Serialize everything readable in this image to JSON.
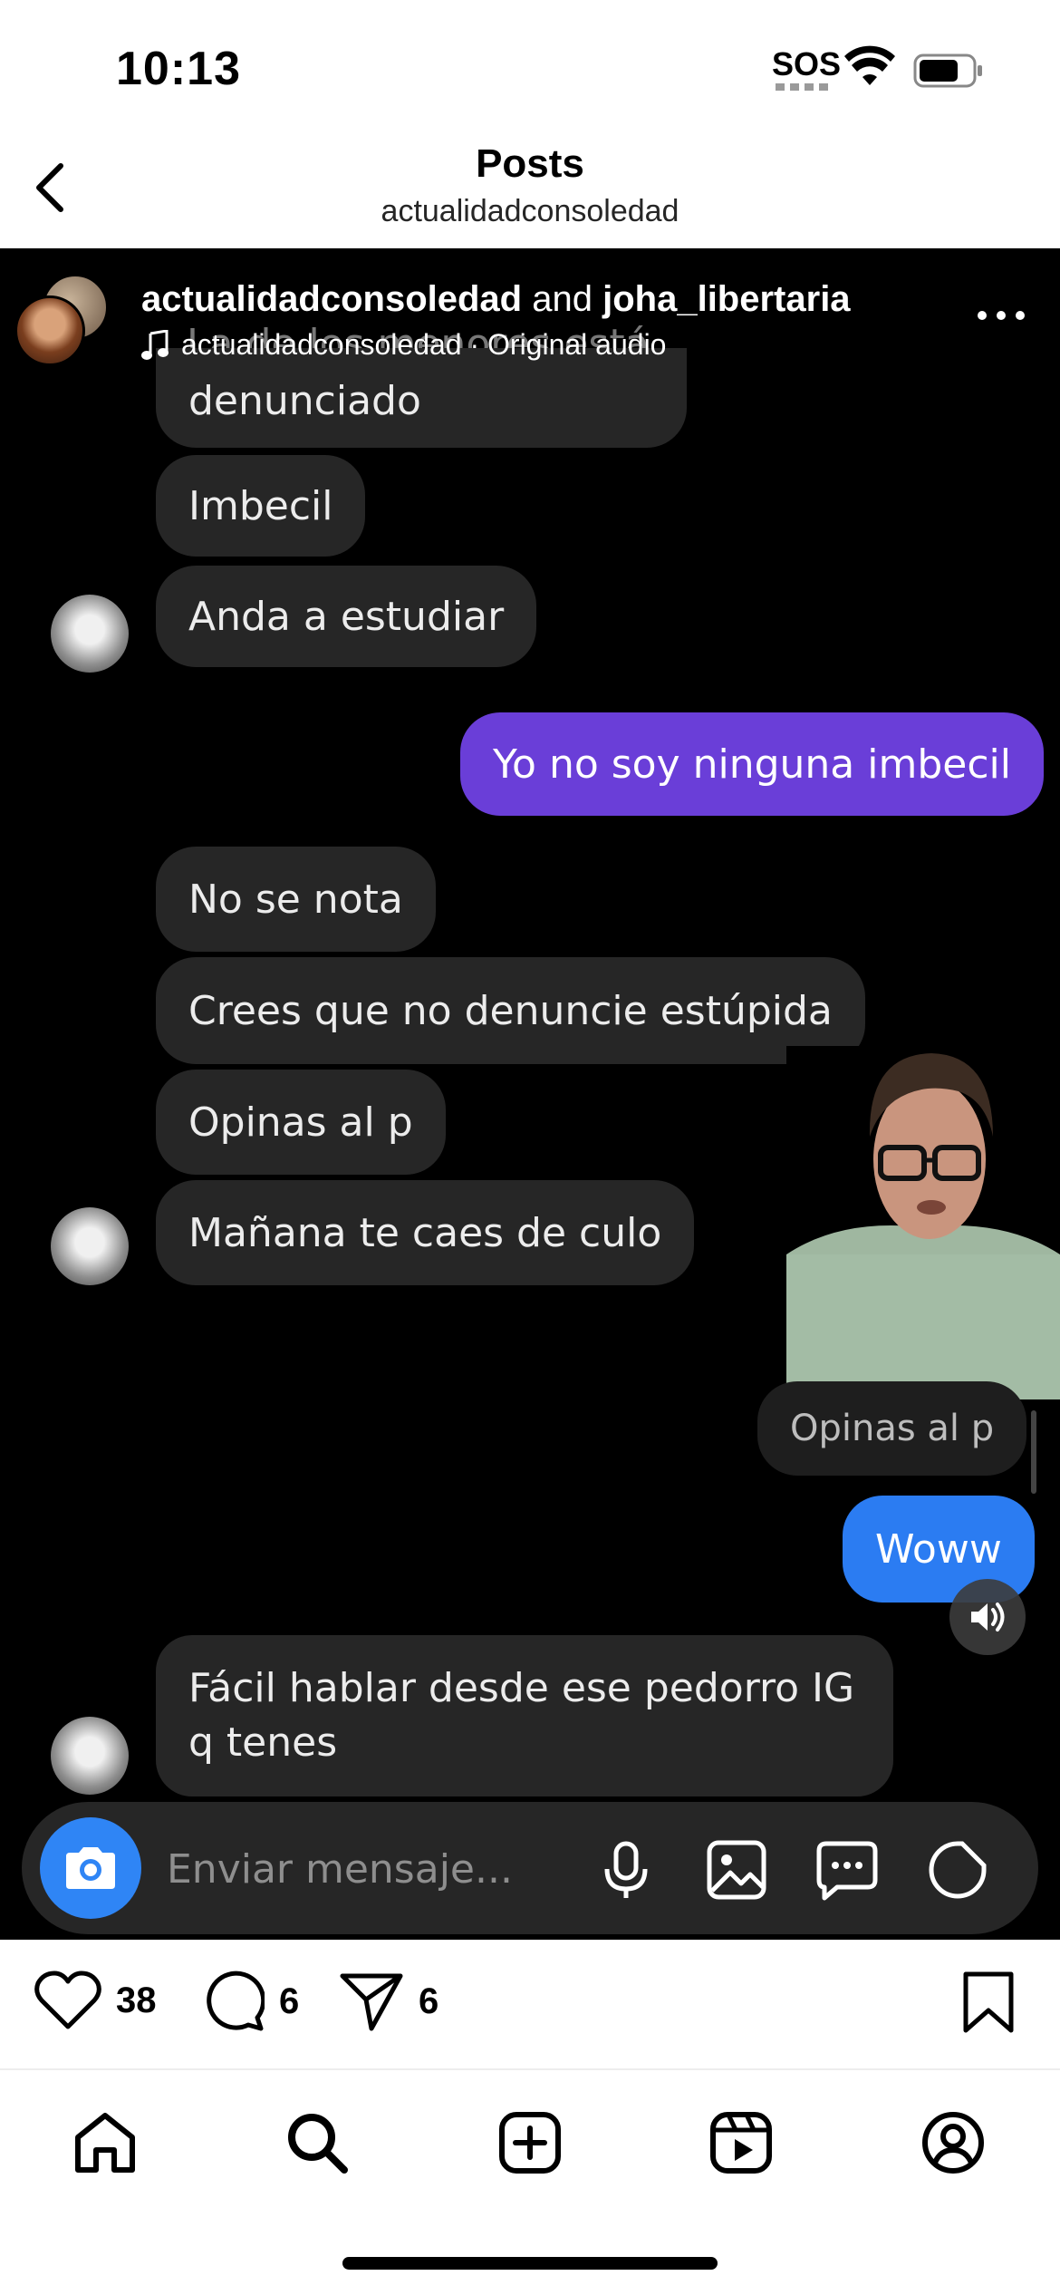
{
  "status_bar": {
    "time": "10:13",
    "sos": "SOS"
  },
  "header": {
    "title": "Posts",
    "subtitle": "actualidadconsoledad"
  },
  "post": {
    "owner_primary": "actualidadconsoledad",
    "owner_joiner": "and",
    "owner_secondary": "joha_libertaria",
    "audio_label": "actualidadconsoledad · Original audio"
  },
  "chat": {
    "ghost_line": "La de los menores está",
    "messages": [
      {
        "text": "denunciado",
        "from": "them"
      },
      {
        "text": "Imbecil",
        "from": "them"
      },
      {
        "text": "Anda a estudiar",
        "from": "them"
      },
      {
        "text": "Yo no soy ninguna imbecil",
        "from": "me"
      },
      {
        "text": "No se nota",
        "from": "them"
      },
      {
        "text": "Crees que no denuncie estúpida",
        "from": "them"
      },
      {
        "text": "Opinas al p",
        "from": "them"
      },
      {
        "text": "Mañana te caes de culo",
        "from": "them"
      },
      {
        "text": "Opinas al p",
        "from": "reply-quote"
      },
      {
        "text": "Woww",
        "from": "me"
      },
      {
        "text": "Fácil hablar desde ese pedorro  IG",
        "from": "them"
      },
      {
        "text": "q tenes",
        "from": "them"
      }
    ],
    "composer_placeholder": "Enviar mensaje..."
  },
  "actions": {
    "likes": "38",
    "comments": "6",
    "shares": "6"
  },
  "colors": {
    "my_bubble_purple": "#6a3ed8",
    "my_bubble_blue": "#2b7cf2",
    "their_bubble": "#262626",
    "camera_button": "#2f85f5"
  },
  "icons": {
    "back": "chevron-left-icon",
    "more": "more-horizontal-icon",
    "audio": "music-note-icon",
    "camera": "camera-icon",
    "mic": "microphone-icon",
    "gallery": "image-icon",
    "chat": "chat-bubble-icon",
    "sticker": "sticker-icon",
    "volume": "speaker-icon",
    "like": "heart-icon",
    "comment": "comment-icon",
    "share": "send-icon",
    "save": "bookmark-icon",
    "tab_home": "home-icon",
    "tab_search": "search-icon",
    "tab_create": "plus-square-icon",
    "tab_reels": "reels-icon",
    "tab_profile": "profile-icon"
  }
}
